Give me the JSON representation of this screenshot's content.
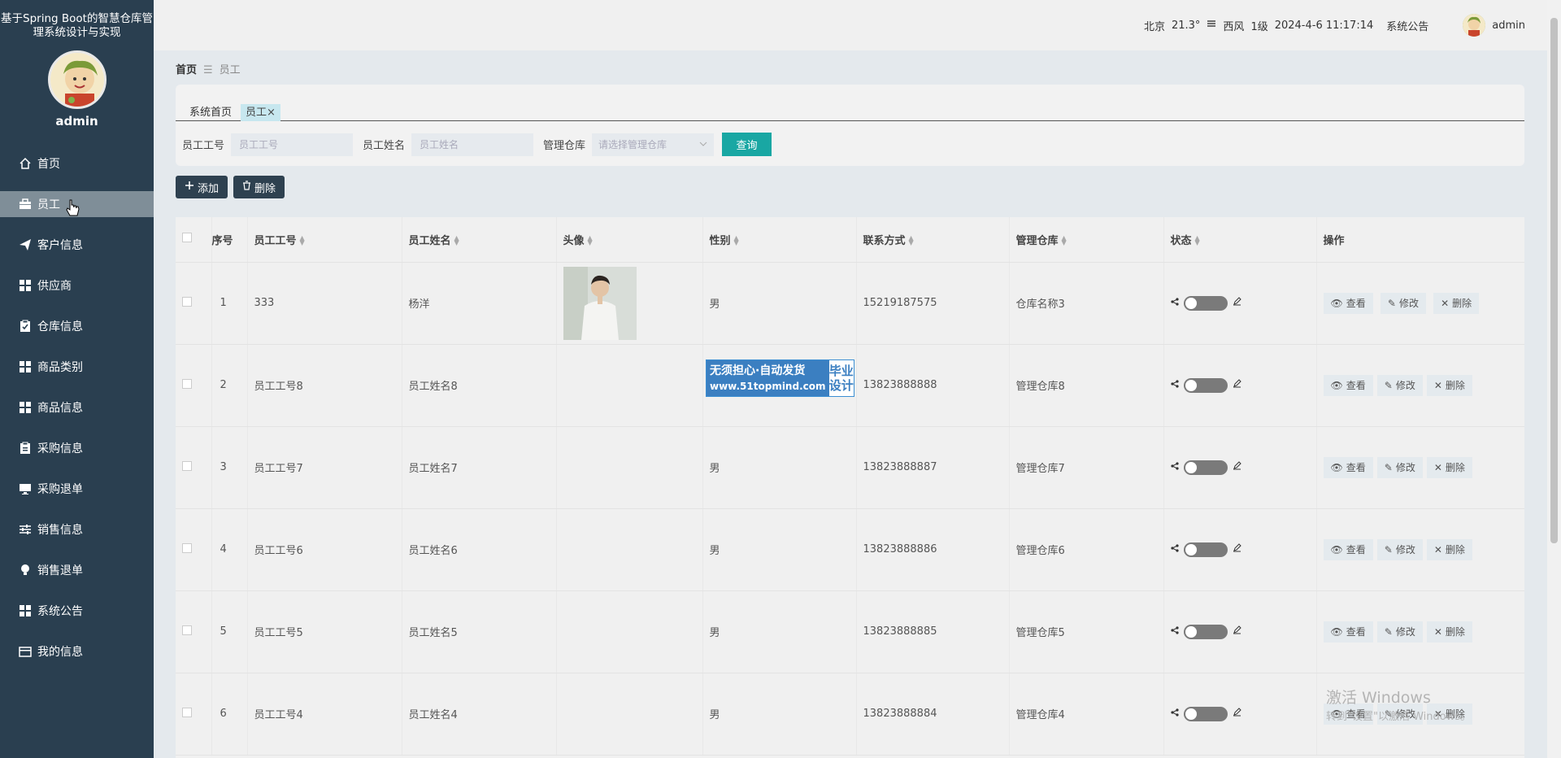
{
  "sidebar": {
    "brand": "基于Spring Boot的智慧仓库管理系统设计与实现",
    "username": "admin",
    "items": [
      {
        "label": "首页",
        "icon": "home-icon"
      },
      {
        "label": "员工",
        "icon": "briefcase-icon"
      },
      {
        "label": "客户信息",
        "icon": "send-icon"
      },
      {
        "label": "供应商",
        "icon": "grid-icon"
      },
      {
        "label": "仓库信息",
        "icon": "clipboard-check-icon"
      },
      {
        "label": "商品类别",
        "icon": "grid-icon"
      },
      {
        "label": "商品信息",
        "icon": "grid-icon"
      },
      {
        "label": "采购信息",
        "icon": "clipboard-icon"
      },
      {
        "label": "采购退单",
        "icon": "monitor-icon"
      },
      {
        "label": "销售信息",
        "icon": "sliders-icon"
      },
      {
        "label": "销售退单",
        "icon": "bulb-icon"
      },
      {
        "label": "系统公告",
        "icon": "grid-icon"
      },
      {
        "label": "我的信息",
        "icon": "card-icon"
      }
    ]
  },
  "header": {
    "city": "北京",
    "temp": "21.3°",
    "wind_dir": "西风",
    "wind_level": "1级",
    "datetime": "2024-4-6 11:17:14",
    "notice": "系统公告",
    "user": "admin"
  },
  "breadcrumb": {
    "home": "首页",
    "current": "员工"
  },
  "tabs": {
    "t1": "系统首页",
    "t2": "员工",
    "t2_close": "×"
  },
  "filters": {
    "label_id": "员工工号",
    "placeholder_id": "员工工号",
    "label_name": "员工姓名",
    "placeholder_name": "员工姓名",
    "label_wh": "管理仓库",
    "placeholder_wh": "请选择管理仓库",
    "query": "查询"
  },
  "actions": {
    "add": "添加",
    "delete": "删除"
  },
  "table": {
    "headers": {
      "seq": "序号",
      "id": "员工工号",
      "name": "员工姓名",
      "avatar": "头像",
      "gender": "性别",
      "phone": "联系方式",
      "warehouse": "管理仓库",
      "status": "状态",
      "ops": "操作"
    },
    "op_view": "查看",
    "op_edit": "修改",
    "op_delete": "删除",
    "rows": [
      {
        "seq": "1",
        "id": "333",
        "name": "杨洋",
        "gender": "男",
        "phone": "15219187575",
        "warehouse": "仓库名称3"
      },
      {
        "seq": "2",
        "id": "员工工号8",
        "name": "员工姓名8",
        "gender": "",
        "phone": "13823888888",
        "warehouse": "管理仓库8"
      },
      {
        "seq": "3",
        "id": "员工工号7",
        "name": "员工姓名7",
        "gender": "男",
        "phone": "13823888887",
        "warehouse": "管理仓库7"
      },
      {
        "seq": "4",
        "id": "员工工号6",
        "name": "员工姓名6",
        "gender": "男",
        "phone": "13823888886",
        "warehouse": "管理仓库6"
      },
      {
        "seq": "5",
        "id": "员工工号5",
        "name": "员工姓名5",
        "gender": "男",
        "phone": "13823888885",
        "warehouse": "管理仓库5"
      },
      {
        "seq": "6",
        "id": "员工工号4",
        "name": "员工姓名4",
        "gender": "男",
        "phone": "13823888884",
        "warehouse": "管理仓库4"
      }
    ]
  },
  "watermark": {
    "line1": "无须担心·自动发货",
    "line2": "www.51topmind.com",
    "right1": "毕业",
    "right2": "设计"
  },
  "activate": {
    "line1": "激活 Windows",
    "line2": "转到\"设置\"以激活 Windows。"
  },
  "colors": {
    "sidebar": "#2a3f50",
    "query": "#19a7a3",
    "dark_button": "#2e4150"
  }
}
